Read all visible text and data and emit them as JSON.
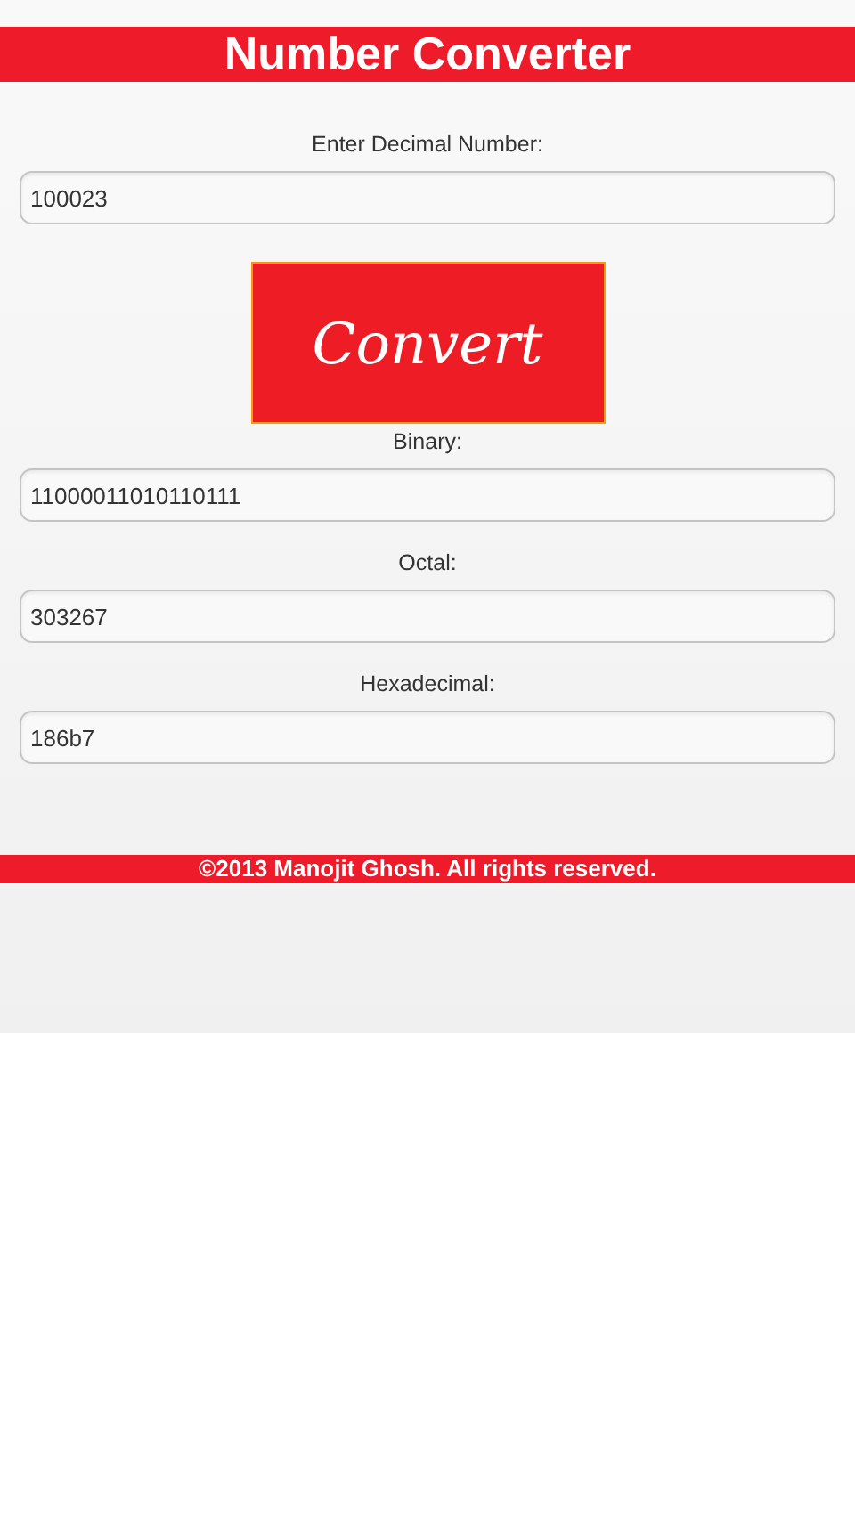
{
  "header": {
    "title": "Number Converter"
  },
  "input": {
    "label": "Enter Decimal Number:",
    "value": "100023"
  },
  "convert_button": {
    "label": "Convert"
  },
  "results": [
    {
      "label": "Binary:",
      "value": "11000011010110111"
    },
    {
      "label": "Octal:",
      "value": "303267"
    },
    {
      "label": "Hexadecimal:",
      "value": "186b7"
    }
  ],
  "footer": {
    "text": "©2013 Manojit Ghosh. All rights reserved."
  }
}
